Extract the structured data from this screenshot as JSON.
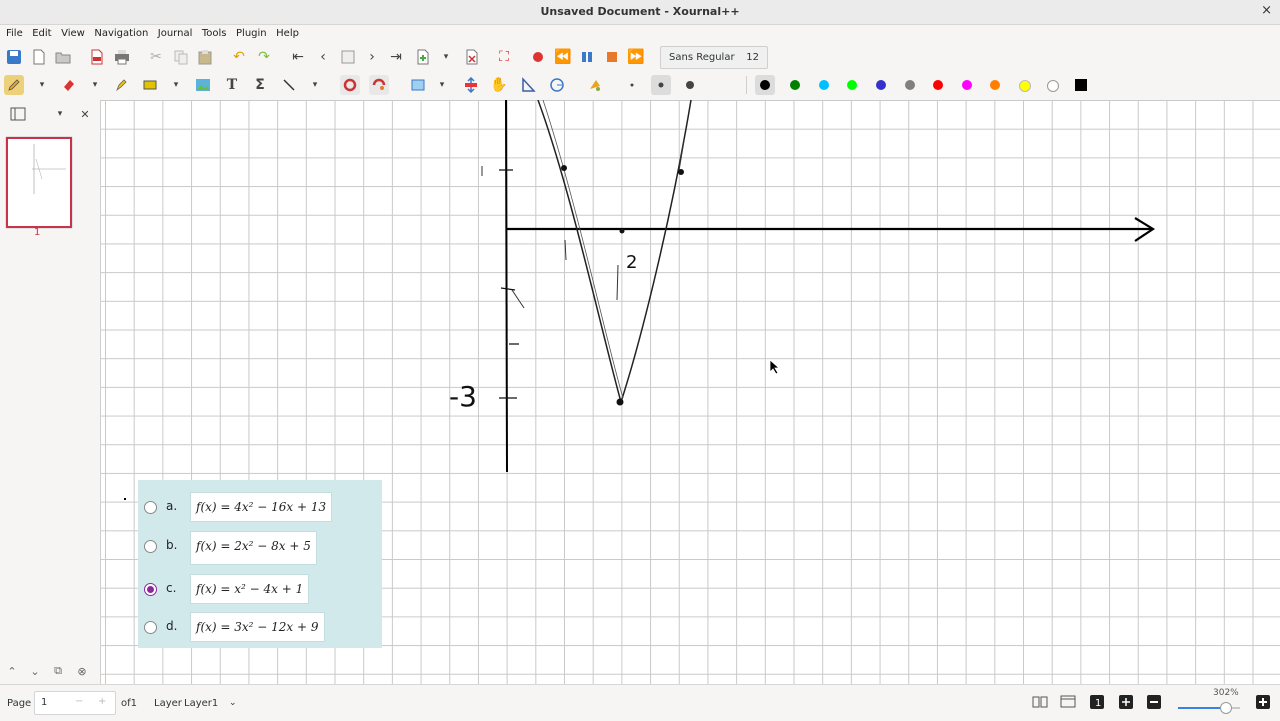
{
  "window": {
    "title": "Unsaved Document - Xournal++",
    "close_label": "×"
  },
  "menu": [
    "File",
    "Edit",
    "View",
    "Navigation",
    "Journal",
    "Tools",
    "Plugin",
    "Help"
  ],
  "toolbar": {
    "font_name": "Sans Regular",
    "font_size": "12",
    "colors": [
      "#000000",
      "#008000",
      "#00c0ff",
      "#00ff00",
      "#3333cc",
      "#808080",
      "#ff0000",
      "#ff00ff",
      "#ff8000",
      "#ffff00",
      "#ffffff"
    ]
  },
  "sidebar": {
    "page_number": "1"
  },
  "quiz": {
    "options": [
      {
        "letter": "a.",
        "formula": "f(x) = 4x² − 16x + 13",
        "selected": false
      },
      {
        "letter": "b.",
        "formula": "f(x) = 2x² − 8x + 5",
        "selected": false
      },
      {
        "letter": "c.",
        "formula": "f(x) = x² − 4x + 1",
        "selected": true
      },
      {
        "letter": "d.",
        "formula": "f(x) = 3x² − 12x + 9",
        "selected": false
      }
    ]
  },
  "status": {
    "page_label": "Page",
    "page_value": "1",
    "page_of": "of1",
    "layer_label": "Layer",
    "layer_value": "Layer1",
    "zoom": "302%"
  },
  "sketch": {
    "label_minus3": "-3",
    "label_2": "2"
  }
}
